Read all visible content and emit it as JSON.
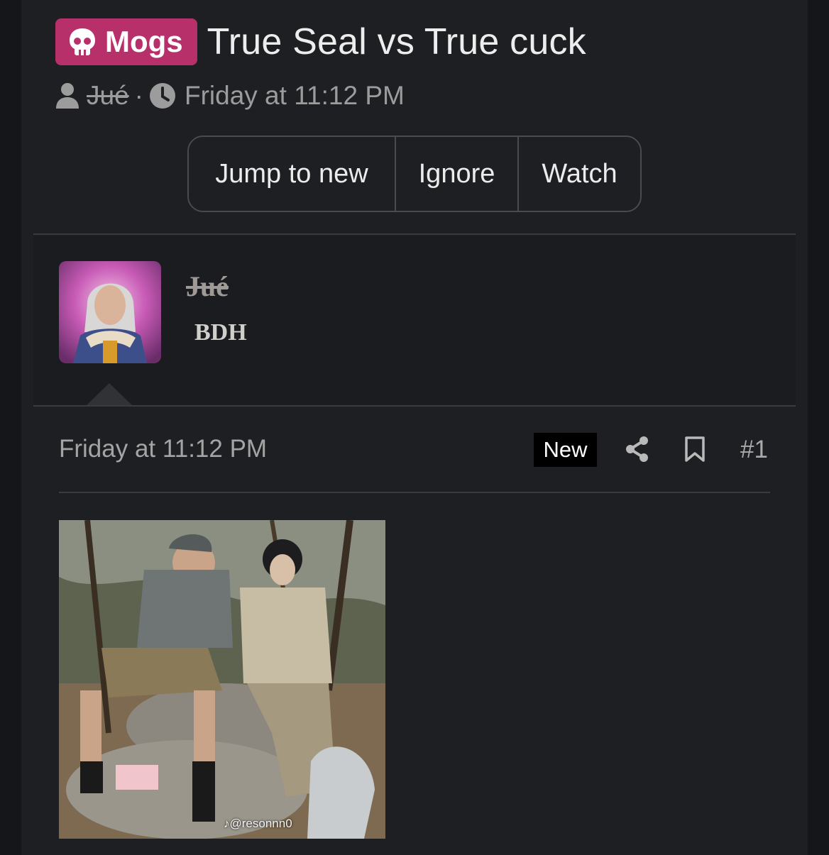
{
  "thread": {
    "prefix_label": "Mogs",
    "title": "True Seal vs True cuck",
    "author": "Jué",
    "separator": "·",
    "date": "Friday at 11:12 PM"
  },
  "actions": {
    "jump_label": "Jump to new",
    "ignore_label": "Ignore",
    "watch_label": "Watch"
  },
  "user": {
    "name": "Jué",
    "title": "BDH"
  },
  "post": {
    "date": "Friday at 11:12 PM",
    "new_label": "New",
    "number": "#1",
    "image_watermark": "@resonnn0"
  },
  "colors": {
    "prefix_bg": "#b8306a",
    "page_bg": "#1e1f22",
    "border": "#4a4b50"
  },
  "icons": [
    "skull-icon",
    "user-icon",
    "clock-icon",
    "share-icon",
    "bookmark-icon",
    "tiktok-icon"
  ]
}
